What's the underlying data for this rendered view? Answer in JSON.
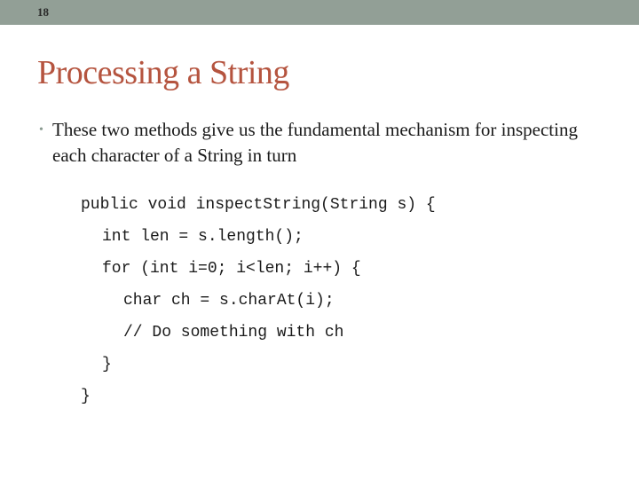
{
  "slide": {
    "number": "18",
    "title": "Processing a String",
    "bullets": [
      {
        "text": "These two methods give us the fundamental mechanism for inspecting each character of a String in turn"
      }
    ],
    "code": [
      {
        "text": "public void inspectString(String s) {",
        "indent": 0
      },
      {
        "text": "int len = s.length();",
        "indent": 1
      },
      {
        "text": "for (int i=0; i<len; i++) {",
        "indent": 1
      },
      {
        "text": "char ch = s.charAt(i);",
        "indent": 2
      },
      {
        "text": "// Do something with ch",
        "indent": 2
      },
      {
        "text": "}",
        "indent": 1
      },
      {
        "text": "}",
        "indent": 0
      }
    ]
  },
  "colors": {
    "header_bar": "#929f96",
    "title": "#b5543f"
  }
}
